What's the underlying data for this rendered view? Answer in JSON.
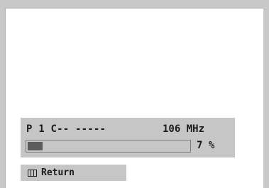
{
  "scan": {
    "program_info": "P 1 C-- -----",
    "frequency": "106 MHz",
    "progress_percent": 7,
    "percent_label": "7 %"
  },
  "footer": {
    "return_icon": "menu-icon",
    "return_label": "Return"
  },
  "colors": {
    "panel": "#c6c6c6",
    "fill": "#5c5c5c",
    "text": "#1a1a1a"
  }
}
